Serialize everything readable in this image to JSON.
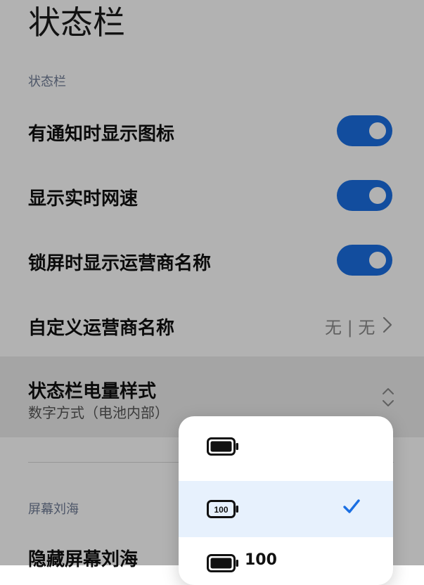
{
  "page": {
    "title": "状态栏"
  },
  "sections": {
    "status_bar": "状态栏",
    "notch": "屏幕刘海"
  },
  "rows": {
    "notify_icons": {
      "label": "有通知时显示图标",
      "enabled": true
    },
    "net_speed": {
      "label": "显示实时网速",
      "enabled": true
    },
    "lock_carrier": {
      "label": "锁屏时显示运营商名称",
      "enabled": true
    },
    "custom_carrier": {
      "label": "自定义运营商名称",
      "value": "无 | 无",
      "chevron": "chevron-right-icon"
    },
    "battery_style": {
      "label": "状态栏电量样式",
      "value": "数字方式（电池内部）",
      "chevron": "chevron-up-down-icon"
    },
    "hide_notch": {
      "label": "隐藏屏幕刘海"
    }
  },
  "popup": {
    "options": [
      {
        "icon": "battery-icon",
        "selected": false
      },
      {
        "icon": "battery-number-inside-icon",
        "badge_text": "100",
        "selected": true
      },
      {
        "icon": "battery-number-beside-icon",
        "text": "100",
        "selected": false
      }
    ],
    "check_icon": "checkmark-icon"
  },
  "colors": {
    "accent": "#1a6fe3",
    "selected_bg": "#e7f1fd",
    "overlay": "rgba(0,0,0,0.30)"
  }
}
